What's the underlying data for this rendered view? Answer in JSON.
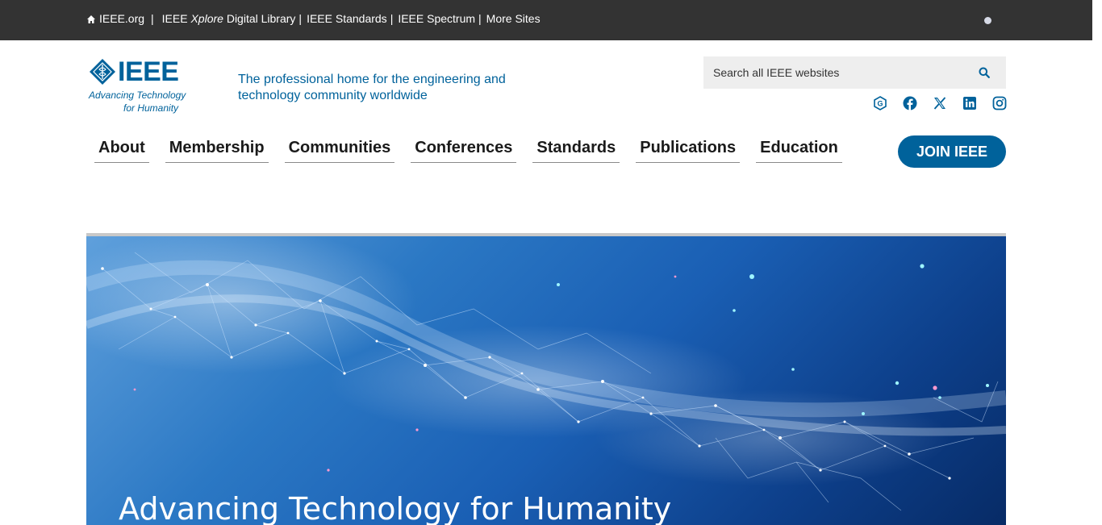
{
  "topbar": {
    "links": [
      "IEEE.org",
      "IEEE Xplore Digital Library",
      "IEEE Standards",
      "IEEE Spectrum",
      "More Sites"
    ],
    "link_ieee_org": "IEEE.org",
    "link_xplore_prefix": "IEEE ",
    "link_xplore_italic": "Xplore",
    "link_xplore_suffix": " Digital Library",
    "link_standards": "IEEE Standards",
    "link_spectrum": "IEEE Spectrum",
    "link_more": "More Sites",
    "separator": "|"
  },
  "header": {
    "logo_word": "IEEE",
    "logo_tag_line1": "Advancing Technology",
    "logo_tag_line2": "for Humanity",
    "tagline": "The professional home for the engineering and technology community worldwide",
    "search_placeholder": "Search all IEEE websites",
    "social_icons": [
      "ieee-collabratec-icon",
      "facebook-icon",
      "x-icon",
      "linkedin-icon",
      "instagram-icon"
    ]
  },
  "nav": {
    "items": [
      "About",
      "Membership",
      "Communities",
      "Conferences",
      "Standards",
      "Publications",
      "Education"
    ],
    "join_label": "JOIN IEEE"
  },
  "hero": {
    "title": "Advancing Technology for Humanity"
  },
  "colors": {
    "brand_blue": "#00629b",
    "topbar_bg": "#333333",
    "search_bg": "#eeeeee"
  }
}
